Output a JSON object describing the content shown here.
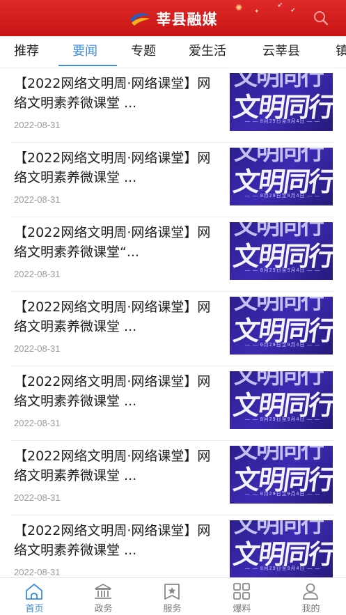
{
  "header": {
    "title": "莘县融媒",
    "accent_color": "#d41c1c"
  },
  "tabs": [
    {
      "label": "推荐",
      "active": false
    },
    {
      "label": "要闻",
      "active": true
    },
    {
      "label": "专题",
      "active": false
    },
    {
      "label": "爱生活",
      "active": false
    },
    {
      "label": "云莘县",
      "active": false
    },
    {
      "label": "镇",
      "active": false
    }
  ],
  "news": [
    {
      "title": "【2022网络文明周·网络课堂】网络文明素养微课堂 ...",
      "date": "2022-08-31",
      "thumb_text": "文明同行",
      "thumb_top": "文明同行",
      "thumb_sub": "— — 8月29日至9月4日 — —"
    },
    {
      "title": "【2022网络文明周·网络课堂】网络文明素养微课堂 ...",
      "date": "2022-08-31",
      "thumb_text": "文明同行",
      "thumb_top": "文明同行",
      "thumb_sub": "— — 8月29日至9月4日 — —"
    },
    {
      "title": "【2022网络文明周·网络课堂】网络文明素养微课堂“...",
      "date": "2022-08-31",
      "thumb_text": "文明同行",
      "thumb_top": "文明同行",
      "thumb_sub": "— — 8月29日至9月4日 — —"
    },
    {
      "title": "【2022网络文明周·网络课堂】网络文明素养微课堂 ...",
      "date": "2022-08-31",
      "thumb_text": "文明同行",
      "thumb_top": "文明同行",
      "thumb_sub": "— — 8月29日至9月4日 — —"
    },
    {
      "title": "【2022网络文明周·网络课堂】网络文明素养微课堂 ...",
      "date": "2022-08-31",
      "thumb_text": "文明同行",
      "thumb_top": "文明同行",
      "thumb_sub": "— — 8月29日至9月4日 — —"
    },
    {
      "title": "【2022网络文明周·网络课堂】网络文明素养微课堂 ...",
      "date": "2022-08-31",
      "thumb_text": "文明同行",
      "thumb_top": "文明同行",
      "thumb_sub": "— — 8月29日至9月4日 — —"
    },
    {
      "title": "【2022网络文明周·网络课堂】网络文明素养微课堂 ...",
      "date": "2022-08-31",
      "thumb_text": "文明同行",
      "thumb_top": "文明同行",
      "thumb_sub": "— — 8月29日至9月4日 — —"
    }
  ],
  "bottom_nav": [
    {
      "label": "首页",
      "icon": "home-icon",
      "active": true
    },
    {
      "label": "政务",
      "icon": "government-icon",
      "active": false
    },
    {
      "label": "服务",
      "icon": "service-icon",
      "active": false
    },
    {
      "label": "爆料",
      "icon": "report-icon",
      "active": false
    },
    {
      "label": "我的",
      "icon": "profile-icon",
      "active": false
    }
  ],
  "colors": {
    "active_blue": "#3b8de0",
    "header_red": "#d41c1c"
  }
}
